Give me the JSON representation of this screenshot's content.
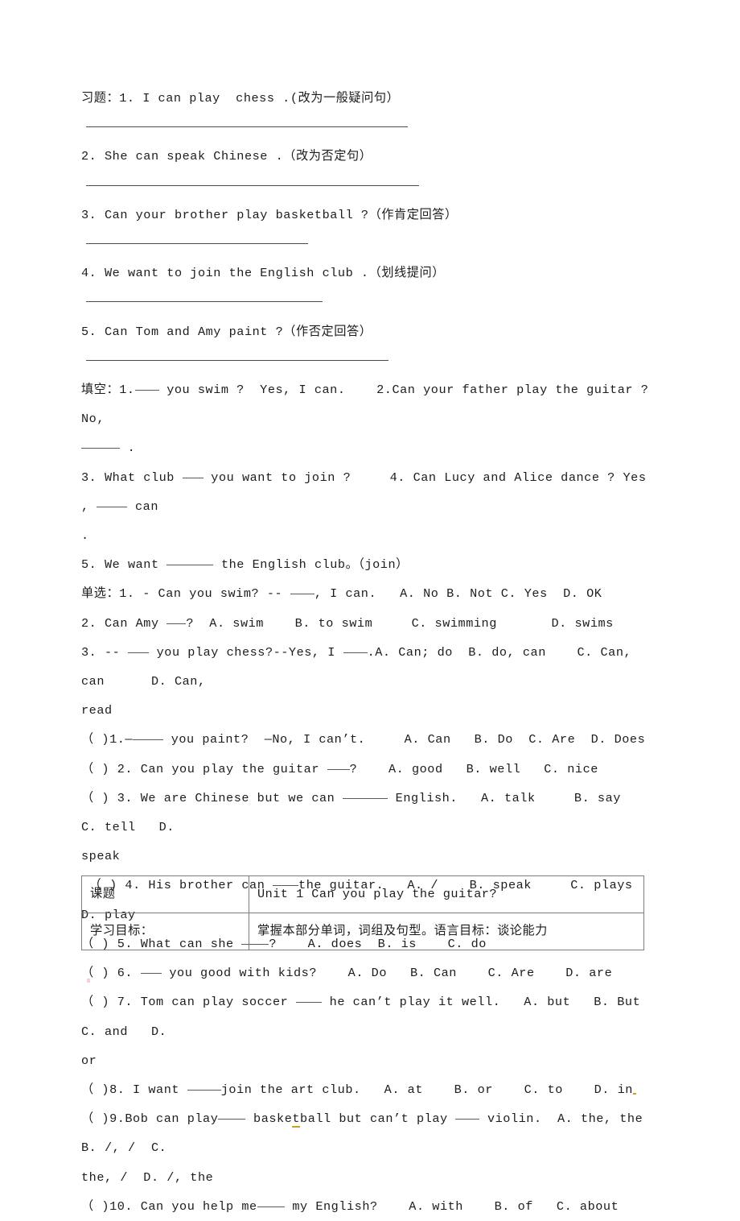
{
  "document": {
    "sections": {
      "rewrite_label": "习题：",
      "fill_label": "填空：",
      "choice_label": "单选："
    },
    "rewrite_items": [
      {
        "number": "1.",
        "text": "I can play  chess .(改为一般疑问句）",
        "answer_rule": true
      },
      {
        "number": "2.",
        "text": "She can speak Chinese .（改为否定句）",
        "answer_rule": true
      },
      {
        "number": "3.",
        "text": "Can your brother play basketball ?（作肯定回答）",
        "answer_rule": true
      },
      {
        "number": "4.",
        "text": "We want to join the English club .（划线提问）",
        "answer_rule": true
      },
      {
        "number": "5.",
        "text": "Can Tom and Amy paint ?（作否定回答）",
        "answer_rule": true
      }
    ],
    "fill_lines": [
      "填空：1.____ you swim ?  Yes, I can.    2.Can your father play the guitar ?   No,",
      "______ .",
      "3. What club ___ you want to join ?     4. Can Lucy and Alice dance ? Yes , _____ can",
      ".",
      "5. We want _______ the English club。（join）"
    ],
    "choice_lines": [
      "单选：1. - Can you swim? -- ____, I can.   A. No B. Not C. Yes  D. OK",
      "2. Can Amy ___?  A. swim    B. to swim     C. swimming       D. swims",
      "3. -- ___ you play chess?--Yes, I ____.A. Can; do  B. do, can    C. Can, can      D. Can,",
      "read"
    ],
    "bracket_questions": [
      "（ )1.—____ you paint?  —No, I can’t.     A. Can   B. Do  C. Are  D. Does",
      "（ ) 2. Can you play the guitar ___?    A. good   B. well   C. nice",
      "（ ) 3. We are Chinese but we can ______ English.   A. talk     B. say      C. tell   D.",
      "speak",
      " （ ) 4. His brother can ____the guitar.   A. /    B. speak     C. plays    D. play",
      "（ ) 5. What can she ____?    A. does  B. is    C. do",
      "（ ) 6. ___ you good with kids?    A. Do   B. Can    C. Are    D. are",
      "（ ) 7. Tom can play soccer ____ he can’t play it well.   A. but   B. But   C. and   D.",
      "or",
      "（ )8. I want _____join the art club.   A. at    B. or    C. to    D. in",
      "（ )9.Bob can play____ basketball but can’t play ____ violin.  A. the, the   B. /, /  C.",
      "the, /  D. /, the",
      "（ )10. Can you help me____ my English?    A. with    B. of   C. about"
    ],
    "table": {
      "rows": [
        {
          "label": "课题",
          "value": "Unit 1 Can you play the guitar?"
        },
        {
          "label": "学习目标：",
          "value": "掌握本部分单词，词组及句型。语言目标：谈论能力"
        }
      ]
    }
  }
}
